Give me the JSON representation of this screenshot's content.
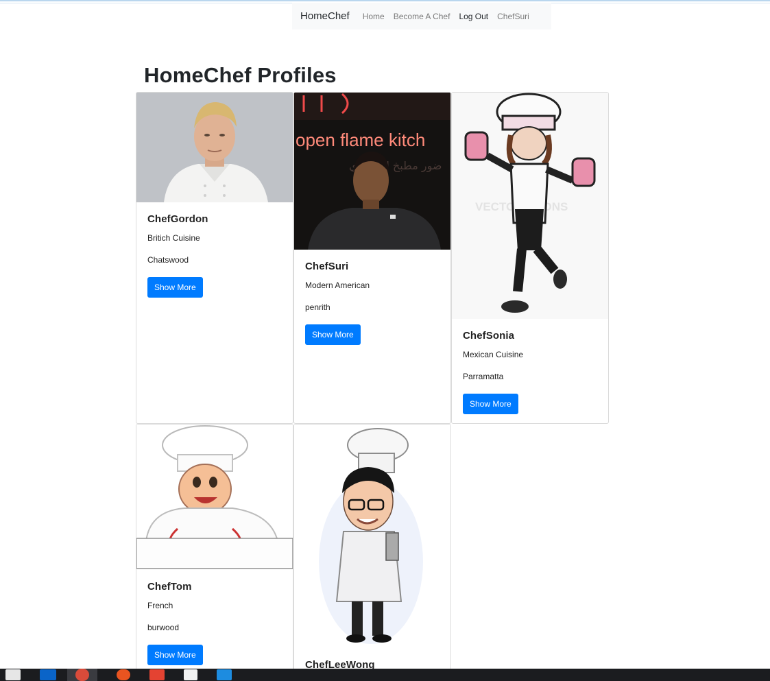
{
  "navbar": {
    "brand": "HomeChef",
    "links": [
      "Home",
      "Become A Chef",
      "Log Out",
      "ChefSuri"
    ]
  },
  "page": {
    "title": "HomeChef Profiles"
  },
  "cards": [
    {
      "name": "ChefGordon",
      "cuisine": "Britich Cuisine",
      "location": "Chatswood",
      "button": "Show More"
    },
    {
      "name": "ChefSuri",
      "cuisine": "Modern American",
      "location": "penrith",
      "button": "Show More",
      "sign_text": "open flame kitch"
    },
    {
      "name": "ChefSonia",
      "cuisine": "Mexican Cuisine",
      "location": "Parramatta",
      "button": "Show More",
      "watermark": "VECTOR TOONS"
    },
    {
      "name": "ChefTom",
      "cuisine": "French",
      "location": "burwood",
      "button": "Show More"
    },
    {
      "name": "ChefLeeWong"
    }
  ],
  "colors": {
    "primary": "#007bff",
    "navbar_bg": "#f8f9fa",
    "taskbar": "#1b1c1f"
  }
}
